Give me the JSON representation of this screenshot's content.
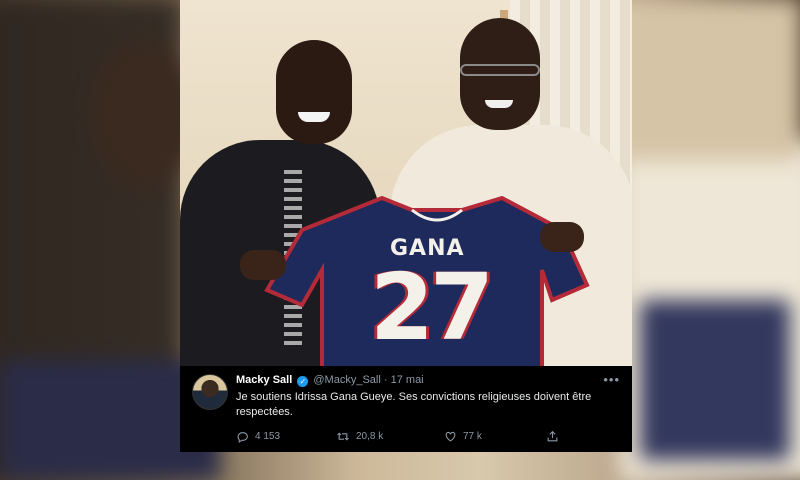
{
  "jersey": {
    "name": "GANA",
    "number": "27"
  },
  "tweet": {
    "author_name": "Macky Sall",
    "handle": "@Macky_Sall",
    "separator": "·",
    "date": "17 mai",
    "text": "Je soutiens Idrissa Gana Gueye. Ses convictions religieuses doivent être respectées.",
    "replies": "4 153",
    "retweets": "20,8 k",
    "likes": "77 k",
    "icons": {
      "verified": "verified-badge-icon",
      "more": "more-options-icon",
      "reply": "reply-icon",
      "retweet": "retweet-icon",
      "like": "heart-icon",
      "share": "share-icon"
    }
  },
  "colors": {
    "tweet_bg": "#000000",
    "verified": "#1d9bf0",
    "jersey_navy": "#1e2a5c",
    "jersey_red": "#b42a38"
  }
}
